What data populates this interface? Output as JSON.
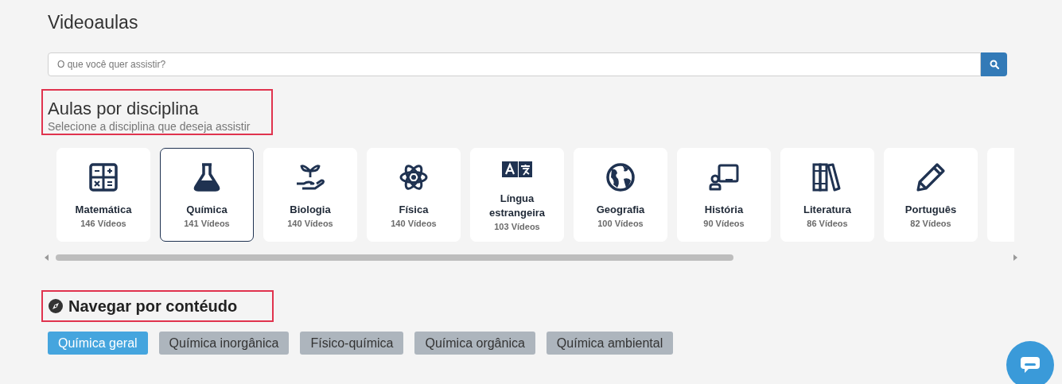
{
  "page_title": "Videoaulas",
  "search": {
    "placeholder": "O que você quer assistir?"
  },
  "subjects_section": {
    "title": "Aulas por disciplina",
    "subtitle": "Selecione a disciplina que deseja assistir"
  },
  "subjects": [
    {
      "name": "Matemática",
      "count": "146 Vídeos",
      "selected": false
    },
    {
      "name": "Química",
      "count": "141 Vídeos",
      "selected": true
    },
    {
      "name": "Biologia",
      "count": "140 Vídeos",
      "selected": false
    },
    {
      "name": "Física",
      "count": "140 Vídeos",
      "selected": false
    },
    {
      "name": "Língua estrangeira",
      "count": "103 Vídeos",
      "selected": false
    },
    {
      "name": "Geografia",
      "count": "100 Vídeos",
      "selected": false
    },
    {
      "name": "História",
      "count": "90 Vídeos",
      "selected": false
    },
    {
      "name": "Literatura",
      "count": "86 Vídeos",
      "selected": false
    },
    {
      "name": "Português",
      "count": "82 Vídeos",
      "selected": false
    }
  ],
  "content_section": {
    "title": "Navegar por contéudo"
  },
  "topics": [
    {
      "label": "Química geral",
      "selected": true
    },
    {
      "label": "Química inorgânica",
      "selected": false
    },
    {
      "label": "Físico-química",
      "selected": false
    },
    {
      "label": "Química orgânica",
      "selected": false
    },
    {
      "label": "Química ambiental",
      "selected": false
    }
  ]
}
